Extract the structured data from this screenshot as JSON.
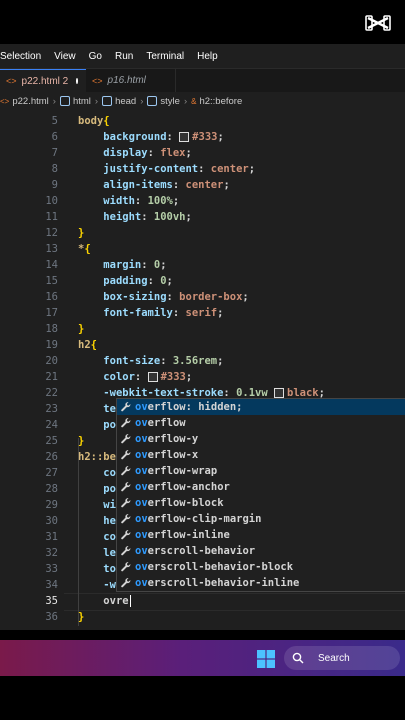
{
  "menu": [
    "Selection",
    "View",
    "Go",
    "Run",
    "Terminal",
    "Help"
  ],
  "tabs": [
    {
      "label": "p22.html",
      "badge": "2",
      "modified": true
    },
    {
      "label": "p16.html"
    }
  ],
  "breadcrumb": [
    "p22.html",
    "html",
    "head",
    "style",
    "h2::before"
  ],
  "lines": [
    {
      "n": "5",
      "parts": [
        [
          "sel",
          "body"
        ],
        [
          "brace",
          "{"
        ]
      ]
    },
    {
      "n": "6",
      "parts": [
        [
          "ws",
          "    "
        ],
        [
          "prop",
          "background"
        ],
        [
          "punc",
          ": "
        ],
        [
          "swatch",
          ""
        ],
        [
          "val",
          "#333"
        ],
        [
          "punc",
          ";"
        ]
      ]
    },
    {
      "n": "7",
      "parts": [
        [
          "ws",
          "    "
        ],
        [
          "prop",
          "display"
        ],
        [
          "punc",
          ": "
        ],
        [
          "val",
          "flex"
        ],
        [
          "punc",
          ";"
        ]
      ]
    },
    {
      "n": "8",
      "parts": [
        [
          "ws",
          "    "
        ],
        [
          "prop",
          "justify-content"
        ],
        [
          "punc",
          ": "
        ],
        [
          "val",
          "center"
        ],
        [
          "punc",
          ";"
        ]
      ]
    },
    {
      "n": "9",
      "parts": [
        [
          "ws",
          "    "
        ],
        [
          "prop",
          "align-items"
        ],
        [
          "punc",
          ": "
        ],
        [
          "val",
          "center"
        ],
        [
          "punc",
          ";"
        ]
      ]
    },
    {
      "n": "10",
      "parts": [
        [
          "ws",
          "    "
        ],
        [
          "prop",
          "width"
        ],
        [
          "punc",
          ": "
        ],
        [
          "num",
          "100%"
        ],
        [
          "punc",
          ";"
        ]
      ]
    },
    {
      "n": "11",
      "parts": [
        [
          "ws",
          "    "
        ],
        [
          "prop",
          "height"
        ],
        [
          "punc",
          ": "
        ],
        [
          "num",
          "100vh"
        ],
        [
          "punc",
          ";"
        ]
      ]
    },
    {
      "n": "12",
      "parts": [
        [
          "brace",
          "}"
        ]
      ]
    },
    {
      "n": "13",
      "parts": [
        [
          "sel",
          "*"
        ],
        [
          "brace",
          "{"
        ]
      ]
    },
    {
      "n": "14",
      "parts": [
        [
          "ws",
          "    "
        ],
        [
          "prop",
          "margin"
        ],
        [
          "punc",
          ": "
        ],
        [
          "num",
          "0"
        ],
        [
          "punc",
          ";"
        ]
      ]
    },
    {
      "n": "15",
      "parts": [
        [
          "ws",
          "    "
        ],
        [
          "prop",
          "padding"
        ],
        [
          "punc",
          ": "
        ],
        [
          "num",
          "0"
        ],
        [
          "punc",
          ";"
        ]
      ]
    },
    {
      "n": "16",
      "parts": [
        [
          "ws",
          "    "
        ],
        [
          "prop",
          "box-sizing"
        ],
        [
          "punc",
          ": "
        ],
        [
          "val",
          "border-box"
        ],
        [
          "punc",
          ";"
        ]
      ]
    },
    {
      "n": "17",
      "parts": [
        [
          "ws",
          "    "
        ],
        [
          "prop",
          "font-family"
        ],
        [
          "punc",
          ": "
        ],
        [
          "val",
          "serif"
        ],
        [
          "punc",
          ";"
        ]
      ]
    },
    {
      "n": "18",
      "parts": [
        [
          "brace",
          "}"
        ]
      ]
    },
    {
      "n": "19",
      "parts": [
        [
          "sel",
          "h2"
        ],
        [
          "brace",
          "{"
        ]
      ]
    },
    {
      "n": "20",
      "parts": [
        [
          "ws",
          "    "
        ],
        [
          "prop",
          "font-size"
        ],
        [
          "punc",
          ": "
        ],
        [
          "num",
          "3.56rem"
        ],
        [
          "punc",
          ";"
        ]
      ]
    },
    {
      "n": "21",
      "parts": [
        [
          "ws",
          "    "
        ],
        [
          "prop",
          "color"
        ],
        [
          "punc",
          ": "
        ],
        [
          "swatch",
          ""
        ],
        [
          "val",
          "#333"
        ],
        [
          "punc",
          ";"
        ]
      ]
    },
    {
      "n": "22",
      "parts": [
        [
          "ws",
          "    "
        ],
        [
          "prop",
          "-webkit-text-stroke"
        ],
        [
          "punc",
          ": "
        ],
        [
          "num",
          "0.1vw"
        ],
        [
          "punc",
          " "
        ],
        [
          "swatch",
          ""
        ],
        [
          "val",
          "black"
        ],
        [
          "punc",
          ";"
        ]
      ]
    },
    {
      "n": "23",
      "parts": [
        [
          "ws",
          "    "
        ],
        [
          "prop",
          "te"
        ]
      ]
    },
    {
      "n": "24",
      "parts": [
        [
          "ws",
          "    "
        ],
        [
          "prop",
          "po"
        ]
      ]
    },
    {
      "n": "25",
      "parts": [
        [
          "brace",
          "}"
        ]
      ]
    },
    {
      "n": "26",
      "parts": [
        [
          "sel",
          "h2::be"
        ]
      ]
    },
    {
      "n": "27",
      "parts": [
        [
          "ws",
          "    "
        ],
        [
          "prop",
          "co"
        ]
      ]
    },
    {
      "n": "28",
      "parts": [
        [
          "ws",
          "    "
        ],
        [
          "prop",
          "po"
        ]
      ]
    },
    {
      "n": "29",
      "parts": [
        [
          "ws",
          "    "
        ],
        [
          "prop",
          "wi"
        ]
      ]
    },
    {
      "n": "30",
      "parts": [
        [
          "ws",
          "    "
        ],
        [
          "prop",
          "he"
        ]
      ]
    },
    {
      "n": "31",
      "parts": [
        [
          "ws",
          "    "
        ],
        [
          "prop",
          "co"
        ]
      ]
    },
    {
      "n": "32",
      "parts": [
        [
          "ws",
          "    "
        ],
        [
          "prop",
          "le"
        ]
      ]
    },
    {
      "n": "33",
      "parts": [
        [
          "ws",
          "    "
        ],
        [
          "prop",
          "to"
        ]
      ]
    },
    {
      "n": "34",
      "parts": [
        [
          "ws",
          "    "
        ],
        [
          "prop",
          "-w"
        ]
      ]
    },
    {
      "n": "35",
      "parts": [
        [
          "ws",
          "    "
        ],
        [
          "punc",
          "ovre"
        ]
      ],
      "current": true
    },
    {
      "n": "36",
      "parts": [
        [
          "brace",
          "}"
        ]
      ]
    }
  ],
  "suggestions": [
    {
      "match": "ov",
      "rest": "erflow: hidden;",
      "selected": true
    },
    {
      "match": "ov",
      "rest": "erflow"
    },
    {
      "match": "ov",
      "rest": "erflow-y"
    },
    {
      "match": "ov",
      "rest": "erflow-x"
    },
    {
      "match": "ov",
      "rest": "erflow-wrap"
    },
    {
      "match": "ov",
      "rest": "erflow-anchor"
    },
    {
      "match": "ov",
      "rest": "erflow-block"
    },
    {
      "match": "ov",
      "rest": "erflow-clip-margin"
    },
    {
      "match": "ov",
      "rest": "erflow-inline"
    },
    {
      "match": "ov",
      "rest": "erscroll-behavior"
    },
    {
      "match": "ov",
      "rest": "erscroll-behavior-block"
    },
    {
      "match": "ov",
      "rest": "erscroll-behavior-inline"
    }
  ],
  "taskbar": {
    "search_label": "Search"
  },
  "icons": {
    "tab": "html-file-icon",
    "suggest": "wrench-icon",
    "breadcrumb": "cube-icon"
  },
  "colors": {
    "property": "#9cdcfe",
    "value": "#ce9178",
    "number": "#b5cea8",
    "selector": "#d7ba7d",
    "brace": "#ffd700",
    "match": "#2f9bff"
  }
}
